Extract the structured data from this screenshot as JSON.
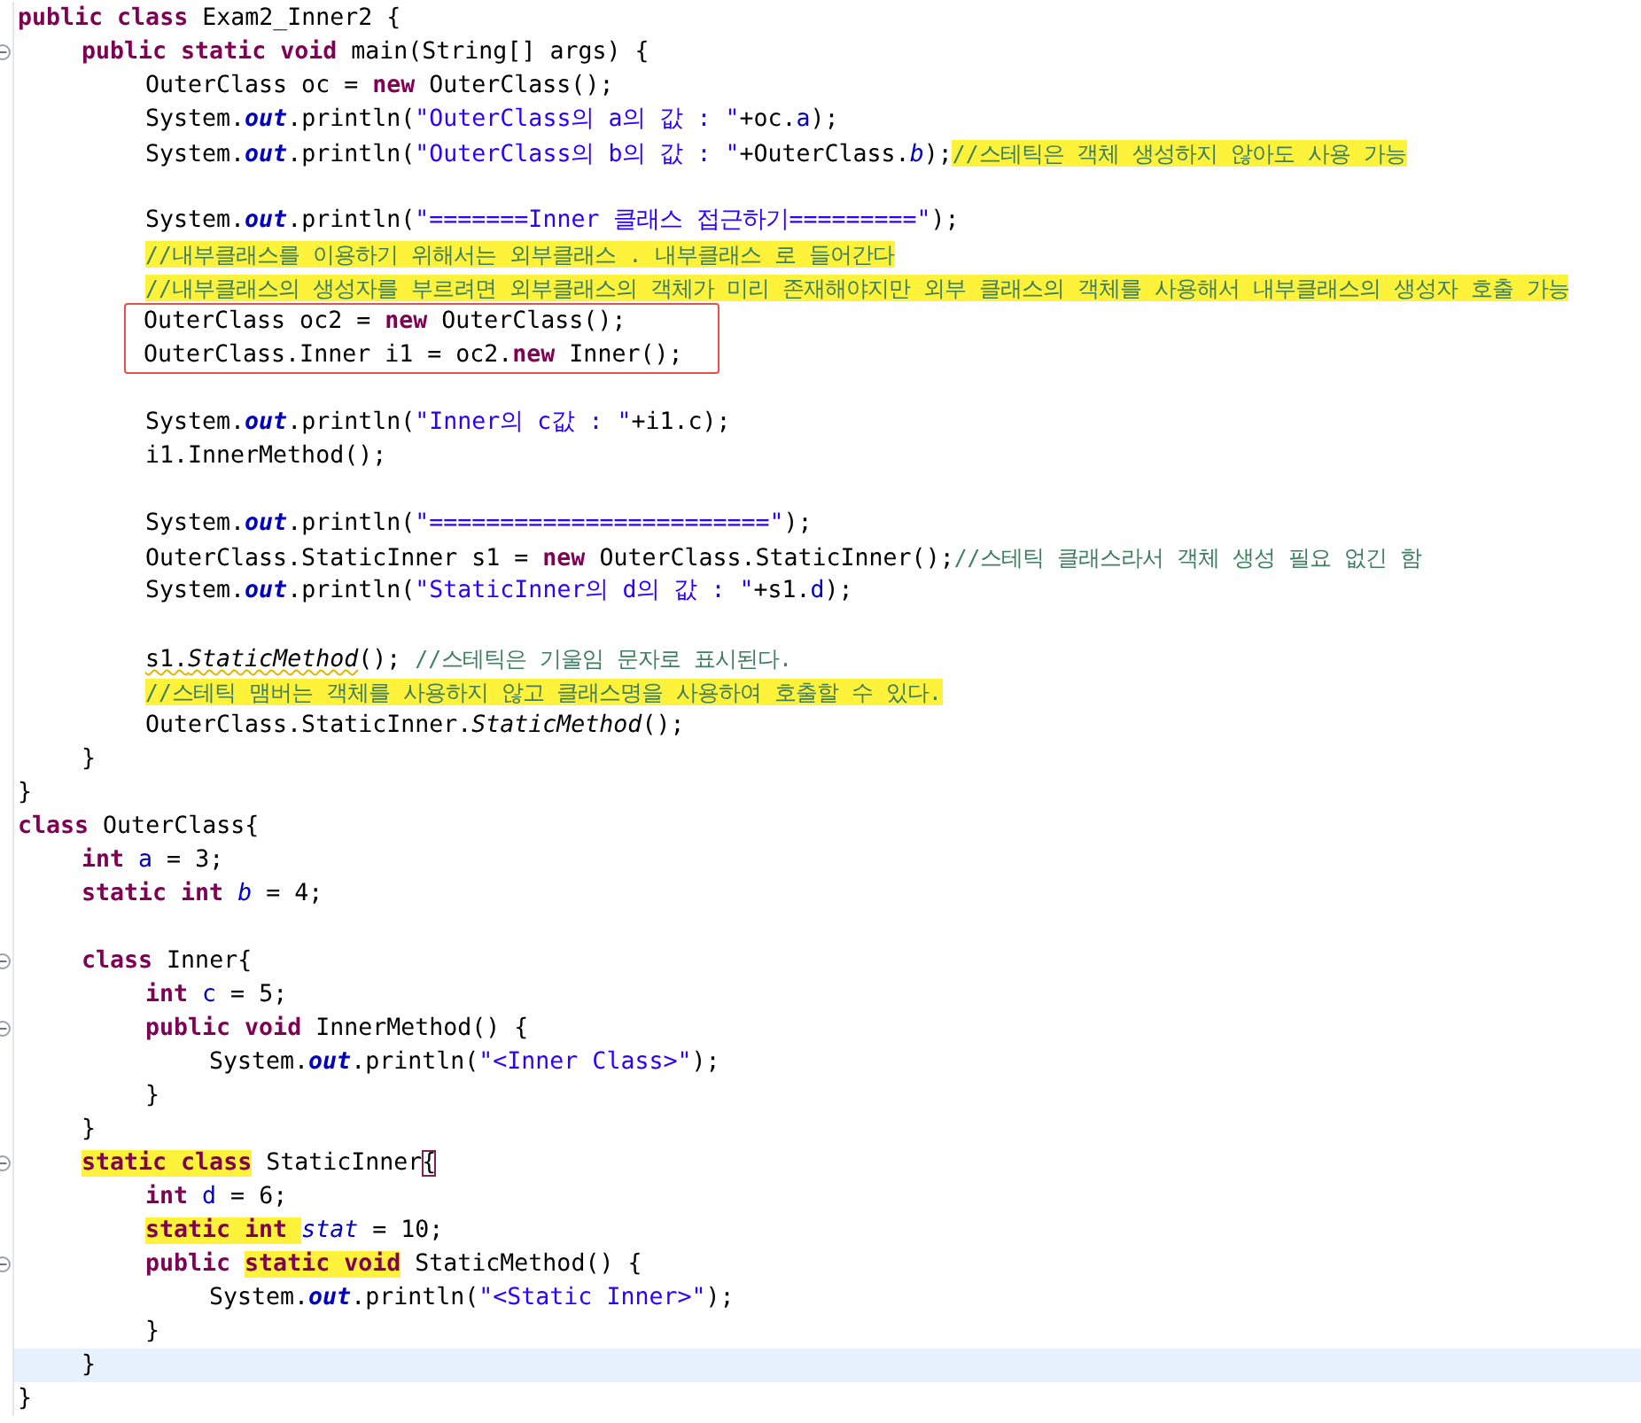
{
  "lines": [
    {
      "fold": false,
      "tokens": [
        {
          "kind": "keyword",
          "text": "public "
        },
        {
          "kind": "keyword",
          "text": "class "
        },
        {
          "kind": "plain",
          "text": "Exam2_Inner2 {"
        }
      ],
      "children": [
        {
          "fold": true,
          "tokens": [
            {
              "kind": "keyword",
              "text": "public "
            },
            {
              "kind": "keyword",
              "text": "static "
            },
            {
              "kind": "keyword",
              "text": "void "
            },
            {
              "kind": "plain",
              "text": "main(String[] args) {"
            }
          ],
          "children": [
            {
              "fold": false,
              "tokens": [
                {
                  "kind": "plain",
                  "text": "OuterClass oc = "
                },
                {
                  "kind": "keyword",
                  "text": "new"
                },
                {
                  "kind": "plain",
                  "text": " OuterClass();"
                }
              ]
            },
            {
              "fold": false,
              "tokens": [
                {
                  "kind": "plain",
                  "text": "System."
                },
                {
                  "kind": "static-out",
                  "text": "out"
                },
                {
                  "kind": "plain",
                  "text": ".println("
                },
                {
                  "kind": "string",
                  "text": "\"OuterClass의 a의 값 : \""
                },
                {
                  "kind": "plain",
                  "text": "+oc."
                },
                {
                  "kind": "field",
                  "text": "a"
                },
                {
                  "kind": "plain",
                  "text": ");"
                }
              ]
            },
            {
              "fold": false,
              "tokens": [
                {
                  "kind": "plain",
                  "text": "System."
                },
                {
                  "kind": "static-out",
                  "text": "out"
                },
                {
                  "kind": "plain",
                  "text": ".println("
                },
                {
                  "kind": "string",
                  "text": "\"OuterClass의 b의 값 : \""
                },
                {
                  "kind": "plain",
                  "text": "+OuterClass."
                },
                {
                  "kind": "static-field",
                  "text": "b"
                },
                {
                  "kind": "plain",
                  "text": ");"
                },
                {
                  "kind": "comment",
                  "text": "//스테틱은 객체 생성하지 않아도 사용 가능",
                  "highlighted": true
                }
              ]
            },
            {
              "fold": false
            },
            {
              "fold": false,
              "tokens": [
                {
                  "kind": "plain",
                  "text": "System."
                },
                {
                  "kind": "static-out",
                  "text": "out"
                },
                {
                  "kind": "plain",
                  "text": ".println("
                },
                {
                  "kind": "string",
                  "text": "\"=======Inner 클래스 접근하기=========\""
                },
                {
                  "kind": "plain",
                  "text": ");"
                }
              ]
            },
            {
              "fold": false,
              "tokens": [
                {
                  "kind": "comment",
                  "text": "//내부클래스를 이용하기 위해서는 외부클래스 . 내부클래스 로 들어간다",
                  "highlighted": true
                }
              ]
            },
            {
              "fold": false,
              "tokens": [
                {
                  "kind": "comment",
                  "text": "//내부클래스의 생성자를 부르려면 외부클래스의 객체가 미리 존재해야지만 외부 클래스의 객체를 사용해서 내부클래스의 생성자 호출 가능",
                  "highlighted": true
                }
              ]
            },
            {
              "fold": false,
              "boxed": true,
              "tokens": [
                {
                  "kind": "plain",
                  "text": "OuterClass oc2 = "
                },
                {
                  "kind": "keyword",
                  "text": "new"
                },
                {
                  "kind": "plain",
                  "text": " OuterClass();"
                }
              ]
            },
            {
              "fold": false,
              "boxed": true,
              "tokens": [
                {
                  "kind": "plain",
                  "text": "OuterClass.Inner i1 = oc2."
                },
                {
                  "kind": "keyword",
                  "text": "new"
                },
                {
                  "kind": "plain",
                  "text": " Inner();"
                }
              ]
            },
            {
              "fold": false
            },
            {
              "fold": false,
              "tokens": [
                {
                  "kind": "plain",
                  "text": "System."
                },
                {
                  "kind": "static-out",
                  "text": "out"
                },
                {
                  "kind": "plain",
                  "text": ".println("
                },
                {
                  "kind": "string",
                  "text": "\"Inner의 c값 : \""
                },
                {
                  "kind": "plain",
                  "text": "+i1.c);"
                }
              ]
            },
            {
              "fold": false,
              "tokens": [
                {
                  "kind": "plain",
                  "text": "i1.InnerMethod();"
                }
              ]
            },
            {
              "fold": false
            },
            {
              "fold": false,
              "tokens": [
                {
                  "kind": "plain",
                  "text": "System."
                },
                {
                  "kind": "static-out",
                  "text": "out"
                },
                {
                  "kind": "plain",
                  "text": ".println("
                },
                {
                  "kind": "string",
                  "text": "\"========================\""
                },
                {
                  "kind": "plain",
                  "text": ");"
                }
              ]
            },
            {
              "fold": false,
              "tokens": [
                {
                  "kind": "plain",
                  "text": "OuterClass.StaticInner s1 = "
                },
                {
                  "kind": "keyword",
                  "text": "new"
                },
                {
                  "kind": "plain",
                  "text": " OuterClass.StaticInner();"
                },
                {
                  "kind": "comment",
                  "text": "//스테틱 클래스라서 객체 생성 필요 없긴 함"
                }
              ]
            },
            {
              "fold": false,
              "tokens": [
                {
                  "kind": "plain",
                  "text": "System."
                },
                {
                  "kind": "static-out",
                  "text": "out"
                },
                {
                  "kind": "plain",
                  "text": ".println("
                },
                {
                  "kind": "string",
                  "text": "\"StaticInner의 d의 값 : \""
                },
                {
                  "kind": "plain",
                  "text": "+s1."
                },
                {
                  "kind": "field",
                  "text": "d"
                },
                {
                  "kind": "plain",
                  "text": ");"
                }
              ]
            },
            {
              "fold": false
            },
            {
              "fold": false,
              "tokens": [
                {
                  "kind": "plain",
                  "text": "s1.",
                  "warning": true
                },
                {
                  "kind": "static-method",
                  "text": "StaticMethod",
                  "warning": true
                },
                {
                  "kind": "plain",
                  "text": "(); "
                },
                {
                  "kind": "comment",
                  "text": "//스테틱은 기울임 문자로 표시된다."
                }
              ]
            },
            {
              "fold": false,
              "tokens": [
                {
                  "kind": "comment",
                  "text": "//스테틱 맴버는 객체를 사용하지 않고 클래스명을 사용하여 호출할 수 있다.",
                  "highlighted": true
                }
              ]
            },
            {
              "fold": false,
              "tokens": [
                {
                  "kind": "plain",
                  "text": "OuterClass.StaticInner."
                },
                {
                  "kind": "static-method",
                  "text": "StaticMethod"
                },
                {
                  "kind": "plain",
                  "text": "();"
                }
              ]
            }
          ]
        },
        {
          "fold": false,
          "tokens": [
            {
              "kind": "plain",
              "text": "}"
            }
          ]
        }
      ]
    },
    {
      "fold": false,
      "tokens": [
        {
          "kind": "plain",
          "text": "}"
        }
      ]
    },
    {
      "fold": false,
      "tokens": [
        {
          "kind": "keyword",
          "text": "class "
        },
        {
          "kind": "plain",
          "text": "OuterClass{"
        }
      ],
      "children": [
        {
          "fold": false,
          "tokens": [
            {
              "kind": "keyword",
              "text": "int "
            },
            {
              "kind": "field",
              "text": "a"
            },
            {
              "kind": "plain",
              "text": " = 3;"
            }
          ]
        },
        {
          "fold": false,
          "tokens": [
            {
              "kind": "keyword",
              "text": "static "
            },
            {
              "kind": "keyword",
              "text": "int "
            },
            {
              "kind": "static-field",
              "text": "b"
            },
            {
              "kind": "plain",
              "text": " = 4;"
            }
          ]
        },
        {
          "fold": false
        },
        {
          "fold": true,
          "tokens": [
            {
              "kind": "keyword",
              "text": "class "
            },
            {
              "kind": "plain",
              "text": "Inner{"
            }
          ],
          "children": [
            {
              "fold": false,
              "tokens": [
                {
                  "kind": "keyword",
                  "text": "int "
                },
                {
                  "kind": "field",
                  "text": "c"
                },
                {
                  "kind": "plain",
                  "text": " = 5;"
                }
              ]
            },
            {
              "fold": true,
              "tokens": [
                {
                  "kind": "keyword",
                  "text": "public "
                },
                {
                  "kind": "keyword",
                  "text": "void "
                },
                {
                  "kind": "plain",
                  "text": "InnerMethod() {"
                }
              ],
              "children": [
                {
                  "fold": false,
                  "tokens": [
                    {
                      "kind": "plain",
                      "text": "System."
                    },
                    {
                      "kind": "static-out",
                      "text": "out"
                    },
                    {
                      "kind": "plain",
                      "text": ".println("
                    },
                    {
                      "kind": "string",
                      "text": "\"<Inner Class>\""
                    },
                    {
                      "kind": "plain",
                      "text": ");"
                    }
                  ]
                }
              ]
            },
            {
              "fold": false,
              "tokens": [
                {
                  "kind": "plain",
                  "text": "}"
                }
              ]
            }
          ]
        },
        {
          "fold": false,
          "tokens": [
            {
              "kind": "plain",
              "text": "}"
            }
          ]
        },
        {
          "fold": true,
          "tokens": [
            {
              "kind": "keyword",
              "text": "static ",
              "highlighted": true
            },
            {
              "kind": "keyword",
              "text": "class",
              "highlighted": true
            },
            {
              "kind": "plain",
              "text": " StaticInner"
            },
            {
              "kind": "plain",
              "text": "{",
              "matched": true
            }
          ],
          "children": [
            {
              "fold": false,
              "tokens": [
                {
                  "kind": "keyword",
                  "text": "int "
                },
                {
                  "kind": "field",
                  "text": "d"
                },
                {
                  "kind": "plain",
                  "text": " = 6;"
                }
              ]
            },
            {
              "fold": false,
              "tokens": [
                {
                  "kind": "keyword",
                  "text": "static ",
                  "highlighted": true
                },
                {
                  "kind": "keyword",
                  "text": "int ",
                  "highlighted": true
                },
                {
                  "kind": "static-field",
                  "text": "stat"
                },
                {
                  "kind": "plain",
                  "text": " = 10;"
                }
              ]
            },
            {
              "fold": true,
              "tokens": [
                {
                  "kind": "keyword",
                  "text": "public "
                },
                {
                  "kind": "keyword",
                  "text": "static ",
                  "highlighted": true
                },
                {
                  "kind": "keyword",
                  "text": "void",
                  "highlighted": true
                },
                {
                  "kind": "plain",
                  "text": " StaticMethod() {"
                }
              ],
              "children": [
                {
                  "fold": false,
                  "tokens": [
                    {
                      "kind": "plain",
                      "text": "System."
                    },
                    {
                      "kind": "static-out",
                      "text": "out"
                    },
                    {
                      "kind": "plain",
                      "text": ".println("
                    },
                    {
                      "kind": "string",
                      "text": "\"<Static Inner>\""
                    },
                    {
                      "kind": "plain",
                      "text": ");"
                    }
                  ]
                }
              ]
            },
            {
              "fold": false,
              "tokens": [
                {
                  "kind": "plain",
                  "text": "}"
                }
              ]
            }
          ]
        },
        {
          "fold": false,
          "current": true,
          "tokens": [
            {
              "kind": "plain",
              "text": "}"
            }
          ]
        }
      ]
    },
    {
      "fold": false,
      "tokens": [
        {
          "kind": "plain",
          "text": "}"
        }
      ]
    }
  ]
}
